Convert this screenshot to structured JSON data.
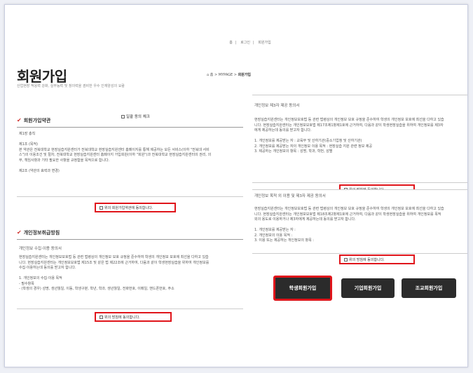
{
  "topnav": {
    "home": "홈",
    "login": "로그인",
    "join": "회원가입"
  },
  "page_title": "회원가입",
  "subtitle": "산업현장 적응력 강화, 실무능력 및 창의력을 겸비한 우수 인재양성의 요람",
  "breadcrumb": {
    "home": "홈",
    "mypage": "MYPAGE",
    "current": "회원가입"
  },
  "all_agree": "일괄 동의 체크",
  "terms": {
    "heading": "회원가입약관",
    "lines": [
      "제1장 총칙",
      "",
      "제1조 (목적)",
      "본 약관은 전북대학교 현장실습지원센터가 전북대학교 현장실습지원센터 홈페이지를 통해 제공하는 모든 서비스(이하 \"전북대 서비",
      "스\")의 이용조건 및 절차, 전북대학교 현장실습지원센터 홈페이지 가입회원(이하 \"회원\")과 전북대학교 현장실습지원센터의 권리, 의",
      "무, 책임사항과 기타 필요한 사항을 규정함을 목적으로 합니다.",
      "",
      "제2조 (약관의 효력과 변경)"
    ],
    "agree": "위의 회원가입약관에 동의합니다."
  },
  "privacy": {
    "heading": "개인정보취급방침",
    "box_title": "개인정보 수집·이용 동의서",
    "lines": [
      "현장실습지원센터는 개인정보보호법 등 관련 법령상의 개인정보 보호 규정을 준수하여 학생의 개인정보 보호에 최선을 다하고 있습",
      "니다.  현장실습지원센터는 개인정보보호법 제15조 및 같은 법 제22조에 근거하여, 다음과 같이 학생현장실습을 위하여 개인정보를",
      "수집·이용하는데 동의를 받고자 합니다.",
      "",
      "1. 개인정보의 수집·이용 목적",
      "- 필수항목",
      "- (학생의 경우) 성명, 생년월일, 이동, 학생구분, 학년, 학과, 생년월일, 전화번호, 이메일, 핸드폰번호, 주소"
    ],
    "agree": "위의 방침에 동의합니다."
  },
  "third_party": {
    "box_title": "개인정보 제3자 제공 동의서",
    "lines": [
      "현장실습지원센터는 개인정보보호법 등 관련 법령상의 개인정보 보호 규정을 준수하여 학생의 개인정보 보호에 최선을 다하고 있습",
      "니다.  현장실습지원센터는 개인정보보호법 제17조제1항제1호에 근거하여, 다음과 같이 학생현장실습을 위하여 개인정보를 제3자",
      "에게 제공하는데 동의를 받고자 합니다.",
      "",
      "1. 개인정보를 제공받는 자 : 교육부 및 산하기관(중소기업청 및 산하기관)",
      "2. 개인정보를 제공받는 자의 개인정보 이용 목적 : 현장실습 지원 관련 정보 제공",
      "3. 제공하는 개인정보의 항목 : 성명, 학과, 학번, 성별"
    ],
    "agree": "위의 방침에 동의합니다."
  },
  "other_use": {
    "box_title": "개인정보 목적 외 이용 및 제3자 제공 동의서",
    "lines": [
      "현장실습지원센터는 개인정보보호법 등 관련 법령상의 개인정보 보호 규정을 준수하여 학생의 개인정보 보호에 최선을 다하고 있습",
      "니다.  현장실습지원센터는 개인정보보호법 제18조제2항제1호에 근거하여, 다음과 같이 학생현장실습을 위하여 개인정보를 목적",
      "외의 용도로 이용하거나 제3자에게 제공하는데 동의를 받고자 합니다.",
      "",
      "1. 개인정보를 제공받는 자 :",
      "2. 개인정보의 이용 목적 :",
      "3. 이용 또는 제공하는 개인정보의 항목 :"
    ],
    "agree": "위의 방침에 동의합니다."
  },
  "buttons": {
    "student": "학생회원가입",
    "company": "기업회원가입",
    "teacher": "조교회원가입"
  }
}
